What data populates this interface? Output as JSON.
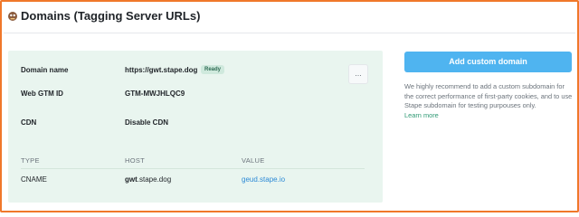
{
  "header": {
    "title": "Domains (Tagging Server URLs)",
    "icon": "stape-logo-icon"
  },
  "details": {
    "rows": [
      {
        "label": "Domain name",
        "value": "https://gwt.stape.dog",
        "badge": "Ready"
      },
      {
        "label": "Web GTM ID",
        "value": "GTM-MWJHLQC9"
      },
      {
        "label": "CDN",
        "value": "Disable CDN"
      }
    ],
    "more_label": "...",
    "table": {
      "headers": [
        "TYPE",
        "HOST",
        "VALUE"
      ],
      "rows": [
        {
          "type": "CNAME",
          "host_bold": "gwt",
          "host_rest": ".stape.dog",
          "value": "geud.stape.io"
        }
      ]
    }
  },
  "sidebar": {
    "add_button": "Add custom domain",
    "info_text": "We highly recommend to add a custom subdomain for the correct performance of first-party cookies, and to use Stape subdomain for testing purpouses only.",
    "learn_more": "Learn more"
  },
  "colors": {
    "accent": "#4fb4f0",
    "panel_bg": "#e9f5ef",
    "frame": "#f0782a",
    "link": "#2d8ad6",
    "learn_more": "#2f9a74"
  }
}
